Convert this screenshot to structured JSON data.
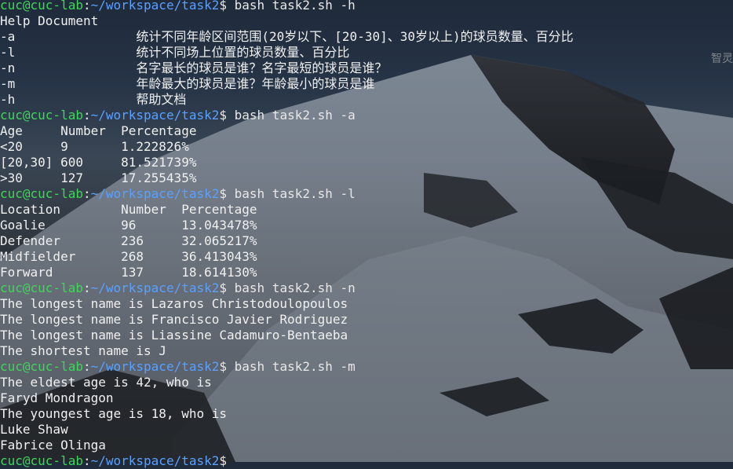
{
  "window": {
    "side_overlay_text": "智灵"
  },
  "prompt": {
    "user_host": "cuc@cuc-lab",
    "sep": ":",
    "path": "~/workspace/task2",
    "dollar": "$ "
  },
  "lines": [
    {
      "type": "prompt",
      "cmd": "bash task2.sh -h"
    },
    {
      "type": "text",
      "text": "Help Document"
    },
    {
      "type": "text",
      "text": "-a                统计不同年龄区间范围(20岁以下、[20-30]、30岁以上)的球员数量、百分比"
    },
    {
      "type": "text",
      "text": "-l                统计不同场上位置的球员数量、百分比"
    },
    {
      "type": "text",
      "text": "-n                名字最长的球员是谁？名字最短的球员是谁？"
    },
    {
      "type": "text",
      "text": "-m                年龄最大的球员是谁？年龄最小的球员是谁"
    },
    {
      "type": "text",
      "text": "-h                帮助文档"
    },
    {
      "type": "prompt",
      "cmd": "bash task2.sh -a"
    },
    {
      "type": "text",
      "text": "Age     Number  Percentage"
    },
    {
      "type": "text",
      "text": "<20     9       1.222826%"
    },
    {
      "type": "text",
      "text": "[20,30] 600     81.521739%"
    },
    {
      "type": "text",
      "text": ">30     127     17.255435%"
    },
    {
      "type": "prompt",
      "cmd": "bash task2.sh -l"
    },
    {
      "type": "text",
      "text": "Location        Number  Percentage"
    },
    {
      "type": "text",
      "text": "Goalie          96      13.043478%"
    },
    {
      "type": "text",
      "text": "Defender        236     32.065217%"
    },
    {
      "type": "text",
      "text": "Midfielder      268     36.413043%"
    },
    {
      "type": "text",
      "text": "Forward         137     18.614130%"
    },
    {
      "type": "prompt",
      "cmd": "bash task2.sh -n"
    },
    {
      "type": "text",
      "text": "The longest name is Lazaros Christodoulopoulos"
    },
    {
      "type": "text",
      "text": "The longest name is Francisco Javier Rodriguez"
    },
    {
      "type": "text",
      "text": "The longest name is Liassine Cadamuro-Bentaeba"
    },
    {
      "type": "text",
      "text": "The shortest name is J"
    },
    {
      "type": "prompt",
      "cmd": "bash task2.sh -m"
    },
    {
      "type": "text",
      "text": "The eldest age is 42, who is"
    },
    {
      "type": "text",
      "text": "Faryd Mondragon"
    },
    {
      "type": "text",
      "text": "The youngest age is 18, who is"
    },
    {
      "type": "text",
      "text": "Luke Shaw"
    },
    {
      "type": "text",
      "text": "Fabrice Olinga"
    },
    {
      "type": "prompt",
      "cmd": ""
    }
  ],
  "colors": {
    "user_host": "#3fd65b",
    "path": "#5aa0ff",
    "text": "#f0f0f0"
  }
}
